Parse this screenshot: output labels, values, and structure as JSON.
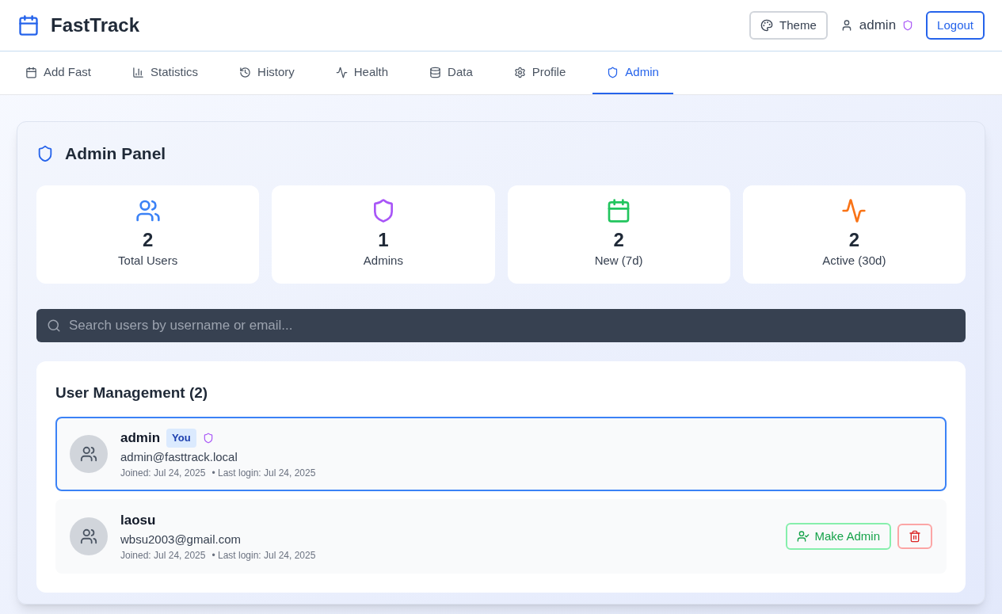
{
  "header": {
    "app_name": "FastTrack",
    "theme_button": "Theme",
    "user": {
      "name": "admin",
      "admin": true
    },
    "logout_button": "Logout"
  },
  "tabs": [
    {
      "label": "Add Fast",
      "selected": false
    },
    {
      "label": "Statistics",
      "selected": false
    },
    {
      "label": "History",
      "selected": false
    },
    {
      "label": "Health",
      "selected": false
    },
    {
      "label": "Data",
      "selected": false
    },
    {
      "label": "Profile",
      "selected": false
    },
    {
      "label": "Admin",
      "selected": true
    }
  ],
  "panel": {
    "title": "Admin Panel",
    "stats": [
      {
        "color": "#3b82f6",
        "value": "2",
        "label": "Total Users"
      },
      {
        "color": "#a855f7",
        "value": "1",
        "label": "Admins"
      },
      {
        "color": "#22c55e",
        "value": "2",
        "label": "New (7d)"
      },
      {
        "color": "#f97316",
        "value": "2",
        "label": "Active (30d)"
      }
    ],
    "search": {
      "placeholder": "Search users by username or email..."
    },
    "users_section": {
      "title": "User Management (2)",
      "users": [
        {
          "name": "admin",
          "badge": "You",
          "admin": true,
          "email": "admin@fasttrack.local",
          "joined": "Joined: Jul 24, 2025",
          "last_login": "• Last login: Jul 24, 2025",
          "selected": true
        },
        {
          "name": "laosu",
          "admin": false,
          "email": "wbsu2003@gmail.com",
          "joined": "Joined: Jul 24, 2025",
          "last_login": "• Last login: Jul 24, 2025",
          "selected": false,
          "actions": [
            {
              "kind": "promote",
              "label": "Make Admin"
            },
            {
              "kind": "delete"
            }
          ]
        }
      ]
    }
  }
}
